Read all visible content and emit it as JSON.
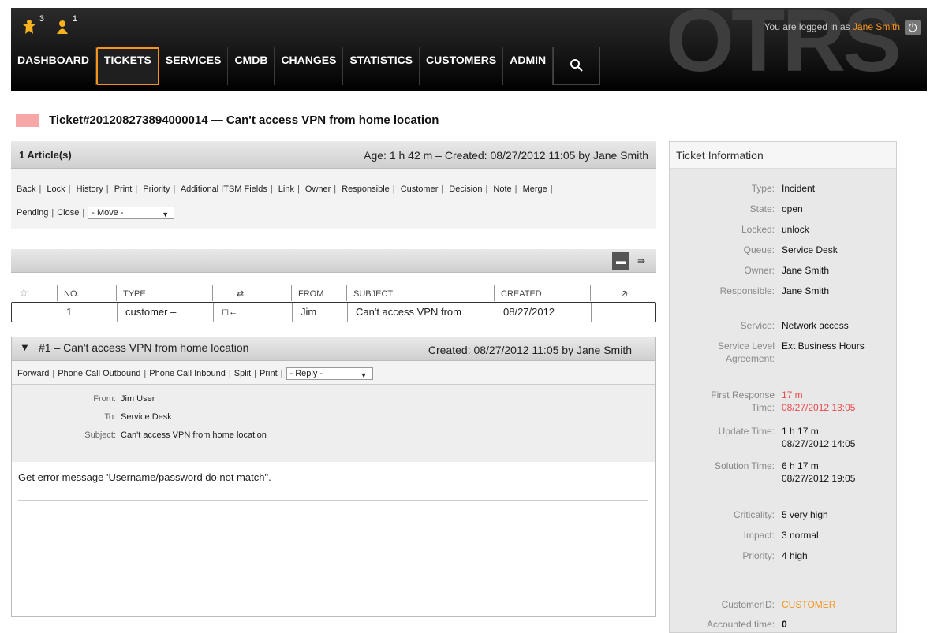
{
  "header": {
    "brand": "OTRS",
    "toolbar": [
      {
        "icon": "escalation-icon",
        "count": "3"
      },
      {
        "icon": "user-icon",
        "count": "1"
      }
    ],
    "login_prefix": "You are logged in as",
    "login_user": "Jane Smith",
    "nav": [
      "DASHBOARD",
      "TICKETS",
      "SERVICES",
      "CMDB",
      "CHANGES",
      "STATISTICS",
      "CUSTOMERS",
      "ADMIN"
    ],
    "nav_selected": "TICKETS"
  },
  "ticket": {
    "priority_color": "#f7a7a7",
    "title": "Ticket#201208273894000014 — Can't access VPN from home location"
  },
  "article_head": {
    "count": "1 Article(s)",
    "age": "Age: 1 h 42 m – Created: 08/27/2012 11:05 by Jane Smith"
  },
  "menu": {
    "row1": [
      "Back",
      "Lock",
      "History",
      "Print",
      "Priority",
      "Additional ITSM Fields",
      "Link",
      "Owner",
      "Responsible",
      "Customer",
      "Decision",
      "Note",
      "Merge"
    ],
    "row2": [
      "Pending",
      "Close"
    ],
    "move_select": "- Move -"
  },
  "article_list": {
    "columns": [
      "NO.",
      "TYPE",
      "⇄",
      "FROM",
      "SUBJECT",
      "CREATED"
    ],
    "row": {
      "no": "1",
      "type": "customer –",
      "direction": "◻←",
      "from": "Jim",
      "subject": "Can't access VPN from",
      "created": "08/27/2012"
    }
  },
  "article": {
    "toggle": "▼",
    "subject": "#1 – Can't access VPN from home location",
    "created": "Created: 08/27/2012 11:05 by Jane Smith",
    "menu": [
      "Forward",
      "Phone Call Outbound",
      "Phone Call Inbound",
      "Split",
      "Print"
    ],
    "reply_select": "- Reply -",
    "meta": [
      {
        "label": "From:",
        "value": "Jim User"
      },
      {
        "label": "To:",
        "value": "Service Desk"
      },
      {
        "label": "Subject:",
        "value": "Can't access VPN from home location"
      }
    ],
    "body": "Get error message 'Username/password do not match\"."
  },
  "sidebar": {
    "title": "Ticket Information",
    "fields": {
      "type": {
        "label": "Type:",
        "value": "Incident"
      },
      "state": {
        "label": "State:",
        "value": "open"
      },
      "locked": {
        "label": "Locked:",
        "value": "unlock"
      },
      "queue": {
        "label": "Queue:",
        "value": "Service Desk"
      },
      "owner": {
        "label": "Owner:",
        "value": "Jane Smith"
      },
      "responsible": {
        "label": "Responsible:",
        "value": "Jane Smith"
      },
      "service": {
        "label": "Service:",
        "value": "Network access"
      },
      "sla_label_1": "Service Level",
      "sla_label_2": "Agreement:",
      "sla_value": "Ext Business Hours",
      "frt_label_1": "First Response",
      "frt_label_2": "Time:",
      "frt_value_1": "17 m",
      "frt_value_2": "08/27/2012 13:05",
      "update_label": "Update Time:",
      "update_value_1": "1 h 17 m",
      "update_value_2": "08/27/2012 14:05",
      "solution_label": "Solution Time:",
      "solution_value_1": "6 h 17 m",
      "solution_value_2": "08/27/2012 19:05",
      "criticality": {
        "label": "Criticality:",
        "value": "5 very high"
      },
      "impact": {
        "label": "Impact:",
        "value": "3 normal"
      },
      "priority": {
        "label": "Priority:",
        "value": "4 high"
      },
      "customerid": {
        "label": "CustomerID:",
        "value": "CUSTOMER"
      },
      "accounted": {
        "label": "Accounted time:",
        "value": "0"
      }
    }
  }
}
